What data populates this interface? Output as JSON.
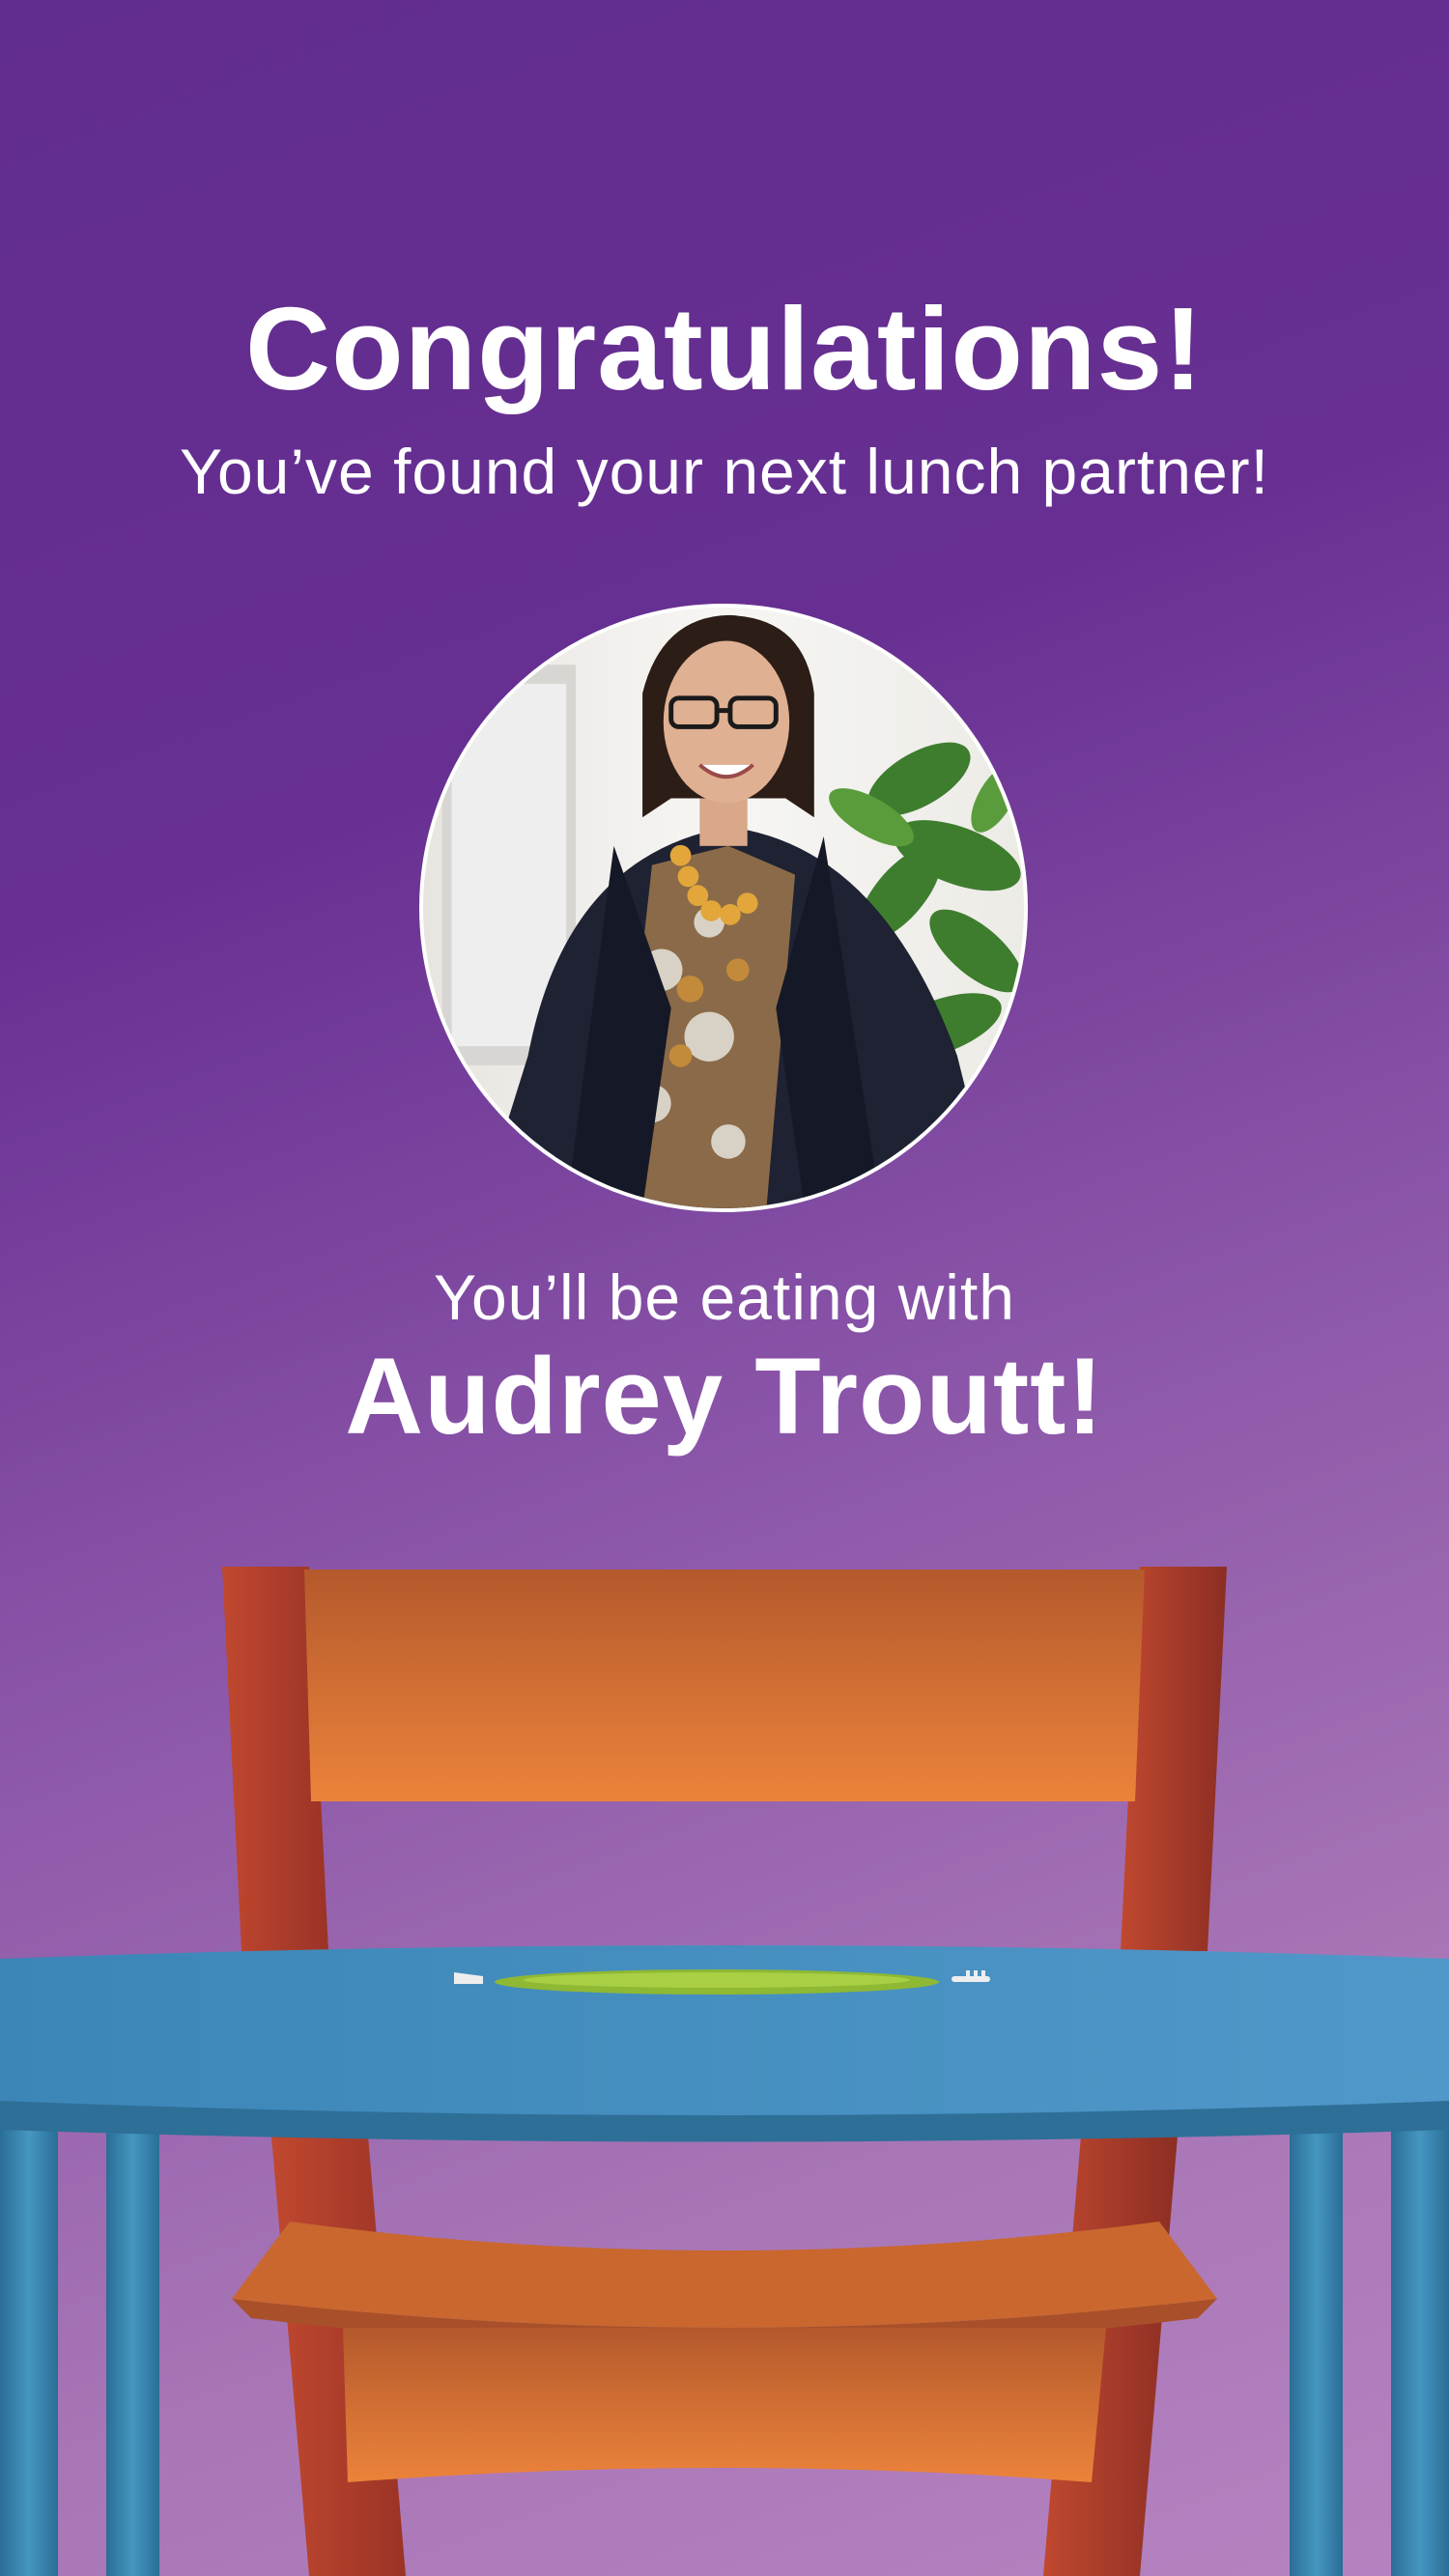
{
  "match": {
    "heading": "Congratulations!",
    "subheading": "You’ve found your next lunch partner!",
    "eating_with_label": "You’ll be eating with",
    "partner_name": "Audrey Troutt!"
  },
  "colors": {
    "background_top": "#612d8e",
    "background_bottom": "#b583c0",
    "text": "#ffffff",
    "chair_frame": "#b9432e",
    "chair_slat": "#e6803a",
    "table": "#3f8fbf",
    "plate": "#9dc43a"
  },
  "icons": [
    "fork-icon",
    "knife-icon"
  ]
}
